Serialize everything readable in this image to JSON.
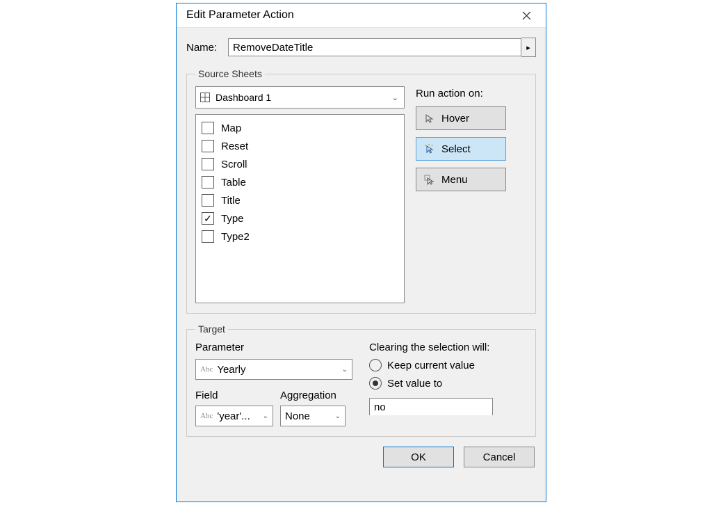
{
  "dialog": {
    "title": "Edit Parameter Action",
    "name_label": "Name:",
    "name_value": "RemoveDateTitle"
  },
  "source": {
    "legend": "Source Sheets",
    "selected_sheet": "Dashboard 1",
    "items": [
      {
        "label": "Map",
        "checked": false
      },
      {
        "label": "Reset",
        "checked": false
      },
      {
        "label": "Scroll",
        "checked": false
      },
      {
        "label": "Table",
        "checked": false
      },
      {
        "label": "Title",
        "checked": false
      },
      {
        "label": "Type",
        "checked": true
      },
      {
        "label": "Type2",
        "checked": false
      }
    ],
    "run_label": "Run action on:",
    "actions": {
      "hover": "Hover",
      "select": "Select",
      "menu": "Menu"
    }
  },
  "target": {
    "legend": "Target",
    "parameter_label": "Parameter",
    "parameter_value": "Yearly",
    "field_label": "Field",
    "field_value": "'year'...",
    "aggregation_label": "Aggregation",
    "aggregation_value": "None",
    "clearing_label": "Clearing the selection will:",
    "keep_label": "Keep current value",
    "set_label": "Set value to",
    "set_value": "no"
  },
  "footer": {
    "ok": "OK",
    "cancel": "Cancel"
  }
}
